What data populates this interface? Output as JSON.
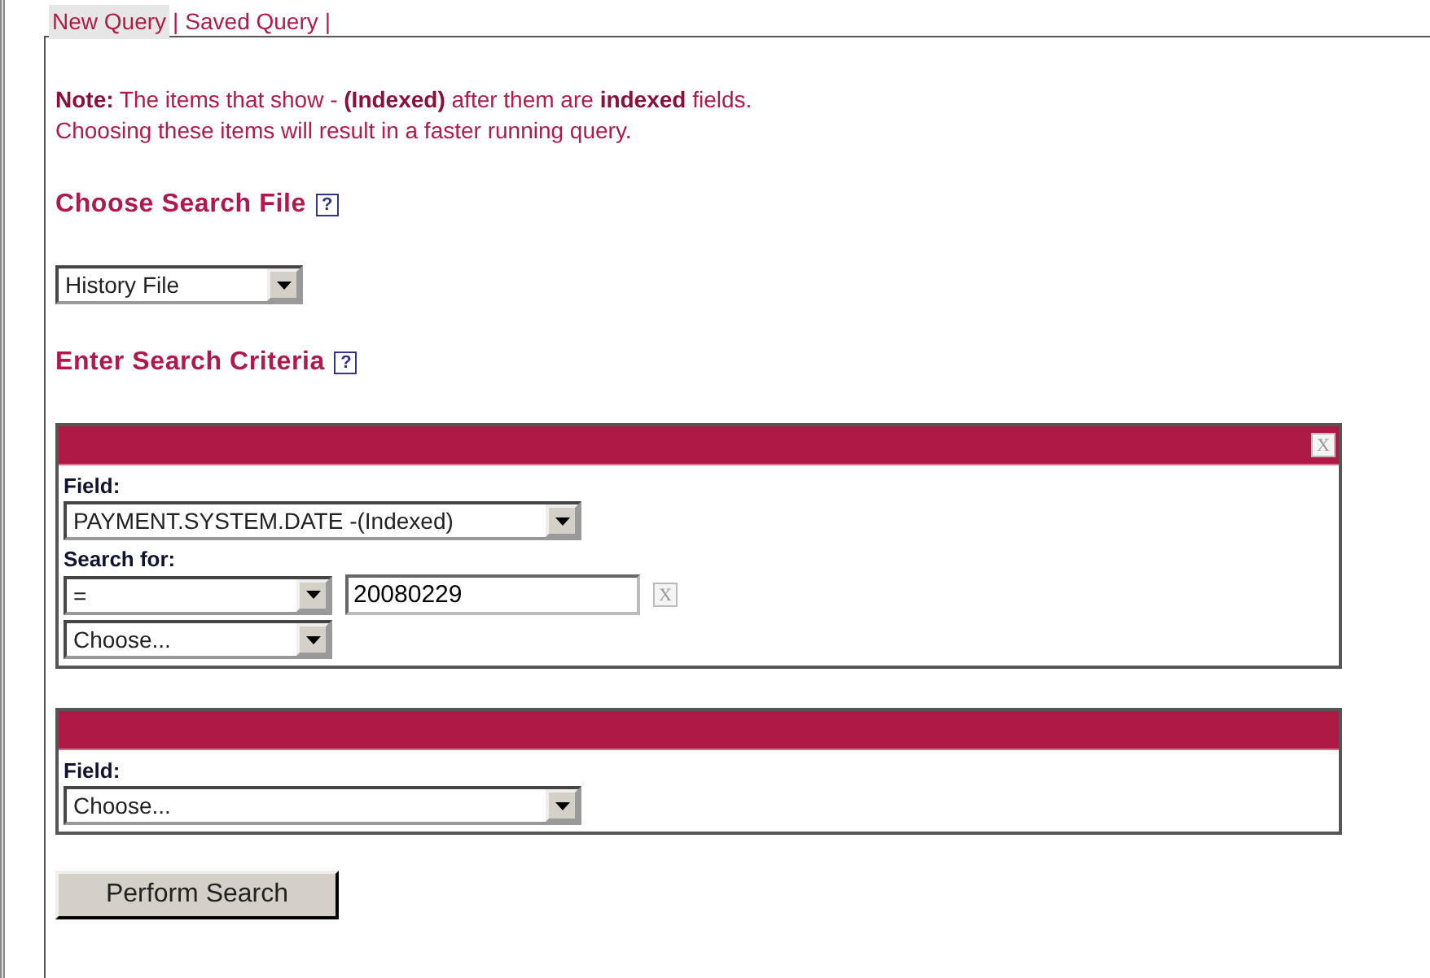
{
  "tabs": [
    {
      "label": "New Query",
      "selected": true,
      "separator": "|"
    },
    {
      "label": "Saved Query",
      "selected": false,
      "separator": "|"
    }
  ],
  "note": [
    "**Note:** The items that show - **(Indexed)** after them are **indexed** fields.",
    "Choosing these items will result in a faster running query."
  ],
  "search_file": {
    "heading": "Choose Search File",
    "help": "?",
    "value": "History File"
  },
  "criteria_heading": {
    "heading": "Enter Search Criteria",
    "help": "?"
  },
  "criteria": [
    {
      "close": "X",
      "field_label": "Field:",
      "field_value": "PAYMENT.SYSTEM.DATE -(Indexed)",
      "search_label": "Search for:",
      "operator": "=",
      "value": "20080229",
      "clear": "X",
      "connector": "Choose..."
    },
    {
      "field_label": "Field:",
      "field_value": "Choose..."
    }
  ],
  "submit": "Perform Search"
}
